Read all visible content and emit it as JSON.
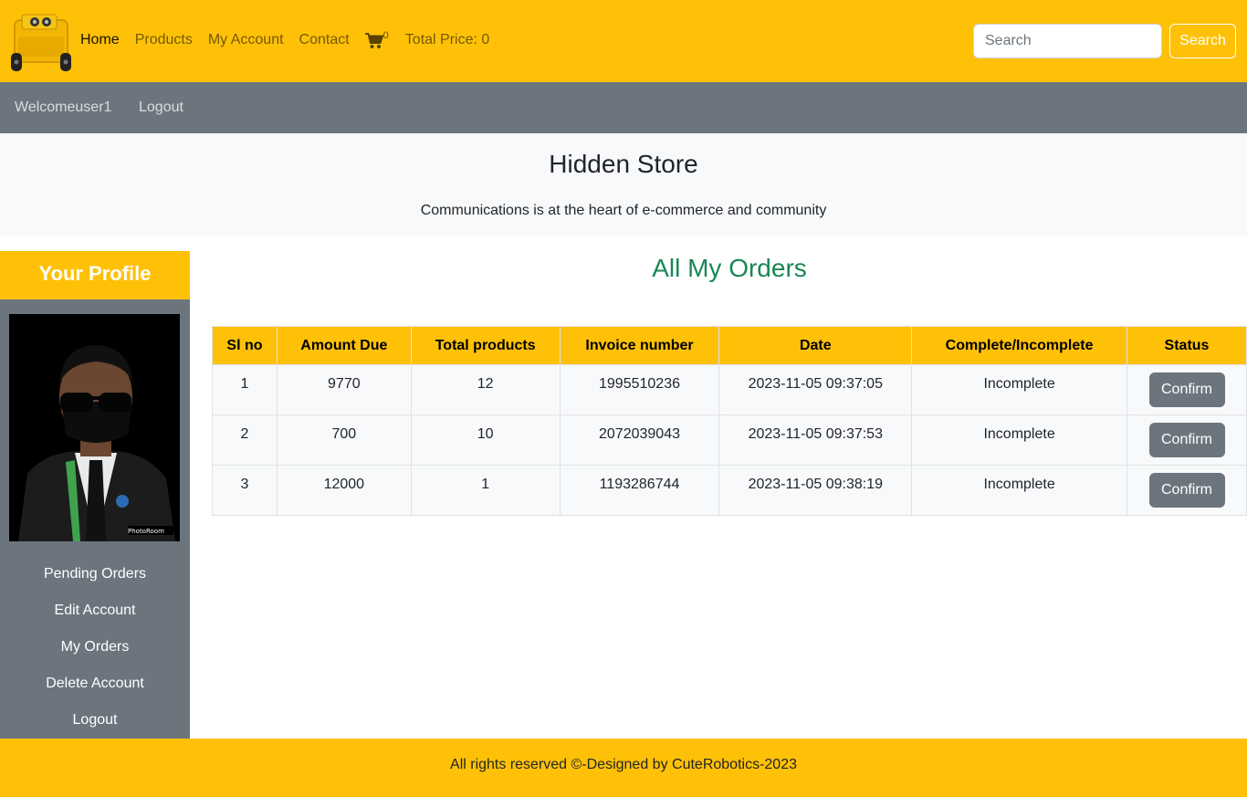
{
  "nav": {
    "links": [
      "Home",
      "Products",
      "My Account",
      "Contact"
    ],
    "cart_count": "0",
    "total_price": "Total Price: 0",
    "search_placeholder": "Search",
    "search_button": "Search"
  },
  "subnav": {
    "welcome": "Welcomeuser1",
    "logout": "Logout"
  },
  "hero": {
    "title": "Hidden Store",
    "tagline": "Communications is at the heart of e-commerce and community"
  },
  "sidebar": {
    "heading": "Your Profile",
    "items": [
      "Pending Orders",
      "Edit Account",
      "My Orders",
      "Delete Account",
      "Logout"
    ]
  },
  "main": {
    "title": "All My Orders",
    "columns": [
      "Sl no",
      "Amount Due",
      "Total products",
      "Invoice number",
      "Date",
      "Complete/Incomplete",
      "Status"
    ],
    "rows": [
      {
        "sl": "1",
        "amount": "9770",
        "products": "12",
        "invoice": "1995510236",
        "date": "2023-11-05 09:37:05",
        "state": "Incomplete",
        "action": "Confirm"
      },
      {
        "sl": "2",
        "amount": "700",
        "products": "10",
        "invoice": "2072039043",
        "date": "2023-11-05 09:37:53",
        "state": "Incomplete",
        "action": "Confirm"
      },
      {
        "sl": "3",
        "amount": "12000",
        "products": "1",
        "invoice": "1193286744",
        "date": "2023-11-05 09:38:19",
        "state": "Incomplete",
        "action": "Confirm"
      }
    ]
  },
  "footer": {
    "text": "All rights reserved ©-Designed by CuteRobotics-2023"
  },
  "colors": {
    "brand_yellow": "#ffc107",
    "secondary_gray": "#6c757d",
    "success_green": "#198754",
    "light": "#f8f9fa"
  },
  "icons": {
    "logo": "robot-logo-icon",
    "cart": "cart-icon"
  }
}
